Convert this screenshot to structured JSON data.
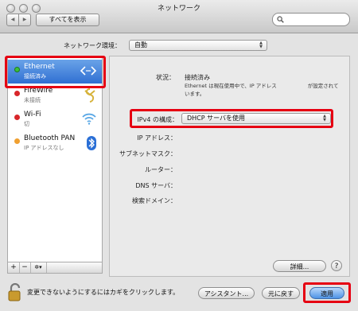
{
  "window": {
    "title": "ネットワーク",
    "show_all": "すべてを表示",
    "nav_back": "◀",
    "nav_forward": "▶"
  },
  "location": {
    "label": "ネットワーク環境：",
    "value": "自動"
  },
  "services": [
    {
      "name": "Ethernet",
      "status": "接続済み",
      "dot_color": "#3cbf3c",
      "icon": "ethernet-icon",
      "selected": true
    },
    {
      "name": "FireWire",
      "status": "未接続",
      "dot_color": "#d8262a",
      "icon": "firewire-icon"
    },
    {
      "name": "Wi-Fi",
      "status": "切",
      "dot_color": "#d8262a",
      "icon": "wifi-icon"
    },
    {
      "name": "Bluetooth PAN",
      "status": "IP アドレスなし",
      "dot_color": "#f0a030",
      "icon": "bluetooth-icon"
    }
  ],
  "sidebar_bar": {
    "add": "+",
    "remove": "−",
    "gear": "✲▾"
  },
  "detail": {
    "status_label": "状況：",
    "status_value": "接続済み",
    "status_desc": "Ethernet は現在使用中で、IP アドレス　　　　　　が設定されています。",
    "ipv4_label": "IPv4 の構成：",
    "ipv4_value": "DHCP サーバを使用",
    "ip_label": "IP アドレス：",
    "subnet_label": "サブネットマスク：",
    "router_label": "ルーター：",
    "dns_label": "DNS サーバ：",
    "search_label": "検索ドメイン：",
    "advanced_button": "詳細...",
    "help_button": "?"
  },
  "footer": {
    "lock_text": "変更できないようにするにはカギをクリックします。",
    "assistant_button": "アシスタント...",
    "revert_button": "元に戻す",
    "apply_button": "適用"
  },
  "colors": {
    "highlight_red": "#e60012",
    "selection_blue": "#2f6fd2"
  }
}
